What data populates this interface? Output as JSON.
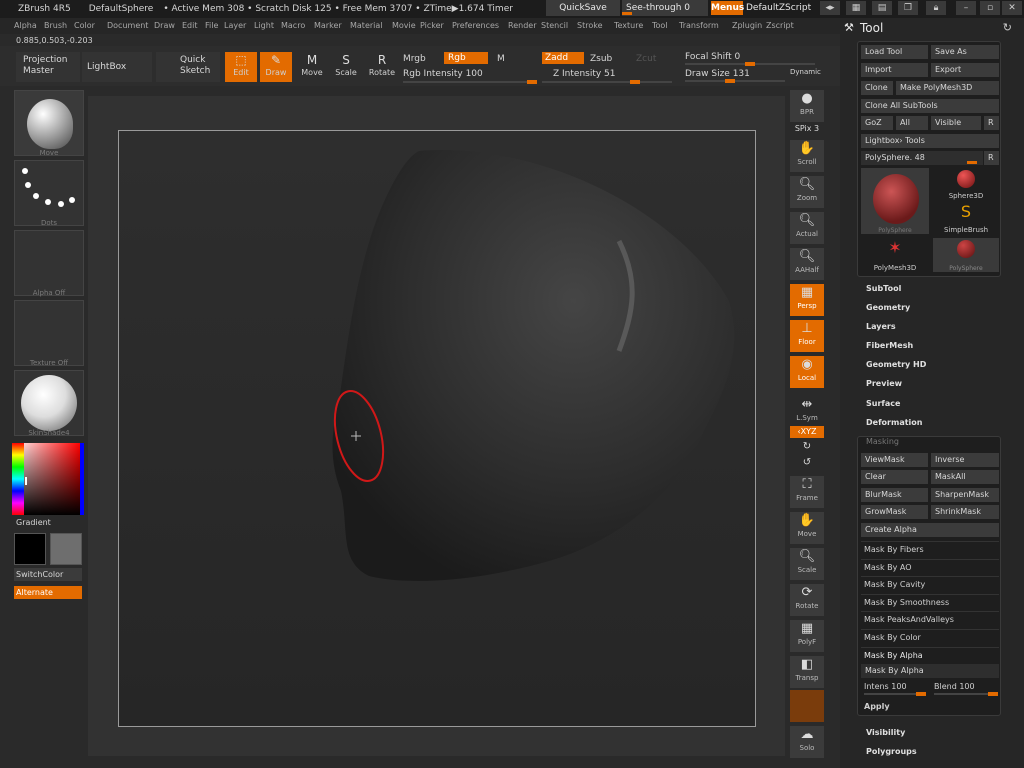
{
  "topbar": {
    "app_title": "ZBrush 4R5",
    "document": "DefaultSphere",
    "stats": "• Active Mem 308 • Scratch Disk 125 • Free Mem 3707 • ZTime▶1.674 Timer",
    "quicksave": "QuickSave",
    "see_through": "See-through  0",
    "menus": "Menus",
    "zscript": "DefaultZScript"
  },
  "menubar": {
    "items": [
      "Alpha",
      "Brush",
      "Color",
      "Document",
      "Draw",
      "Edit",
      "File",
      "Layer",
      "Light",
      "Macro",
      "Marker",
      "Material",
      "Movie",
      "Picker",
      "Preferences",
      "Render",
      "Stencil",
      "Stroke",
      "Texture",
      "Tool",
      "Transform",
      "Zplugin",
      "Zscript"
    ]
  },
  "coords": "0.885,0.503,-0.203",
  "toolbar": {
    "projection_master": "Projection Master",
    "lightbox": "LightBox",
    "quick_sketch": "Quick Sketch",
    "edit": "Edit",
    "draw": "Draw",
    "move": "Move",
    "scale": "Scale",
    "rotate": "Rotate",
    "mrgb": "Mrgb",
    "rgb": "Rgb",
    "m": "M",
    "rgb_intensity": "Rgb  Intensity 100",
    "zadd": "Zadd",
    "zsub": "Zsub",
    "zcut": "Zcut",
    "z_intensity": "Z  Intensity 51",
    "focal_shift": "Focal Shift 0",
    "draw_size": "Draw Size 131",
    "dynamic": "Dynamic"
  },
  "left": {
    "brush_label": "Move",
    "stroke_label": "Dots",
    "alpha_label": "Alpha Off",
    "texture_label": "Texture Off",
    "material_label": "SkinShade4",
    "gradient": "Gradient",
    "switchcolor": "SwitchColor",
    "alternate": "Alternate"
  },
  "right": {
    "bpr": "BPR",
    "spix": "SPix 3",
    "scroll": "Scroll",
    "zoom": "Zoom",
    "actual": "Actual",
    "aahalf": "AAHalf",
    "persp": "Persp",
    "floor": "Floor",
    "local": "Local",
    "lsym": "L.Sym",
    "xyz": "‹XYZ",
    "frame": "Frame",
    "move": "Move",
    "scale": "Scale",
    "rotate": "Rotate",
    "polyf": "PolyF",
    "transp": "Transp",
    "solo": "Solo"
  },
  "panel": {
    "title": "Tool",
    "load_tool": "Load Tool",
    "save_as": "Save As",
    "import": "Import",
    "export": "Export",
    "clone": "Clone",
    "make_polymesh": "Make PolyMesh3D",
    "clone_all": "Clone All SubTools",
    "goz": "GoZ",
    "all": "All",
    "visible": "Visible",
    "r": "R",
    "lightbox_tools": "Lightbox› Tools",
    "current_tool": "PolySphere. 48",
    "tools": [
      "PolySphere",
      "Sphere3D",
      "SimpleBrush",
      "PolyMesh3D",
      "PolySphere"
    ],
    "sections_top": [
      "SubTool",
      "Geometry",
      "Layers",
      "FiberMesh",
      "Geometry HD",
      "Preview",
      "Surface",
      "Deformation"
    ],
    "masking": {
      "title": "Masking",
      "viewmask": "ViewMask",
      "inverse": "Inverse",
      "clear": "Clear",
      "maskall": "MaskAll",
      "blurmask": "BlurMask",
      "sharpenmask": "SharpenMask",
      "growmask": "GrowMask",
      "shrinkmask": "ShrinkMask",
      "create_alpha": "Create Alpha",
      "items": [
        "Mask By Fibers",
        "Mask By AO",
        "Mask By Cavity",
        "Mask By Smoothness",
        "Mask PeaksAndValleys",
        "Mask By Color",
        "Mask By Alpha"
      ],
      "mask_by_alpha_field": "Mask By Alpha",
      "intens": "Intens 100",
      "blend": "Blend 100",
      "apply": "Apply"
    },
    "sections_bottom": [
      "Visibility",
      "Polygroups"
    ]
  },
  "colors": {
    "accent": "#e36b00",
    "bg": "#2a2a2a",
    "panel": "#262626"
  }
}
